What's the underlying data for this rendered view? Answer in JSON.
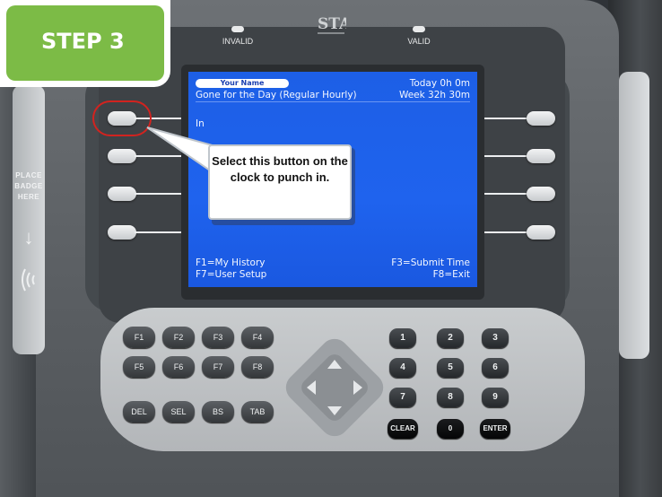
{
  "step": {
    "label": "STEP 3"
  },
  "device": {
    "indicators": [
      {
        "label": "INVALID"
      },
      {
        "label": "VALID"
      }
    ],
    "badge_area": {
      "text": "PLACE BADGE HERE"
    }
  },
  "screen": {
    "user_name": "Your Name",
    "today": "Today  0h 0m",
    "status": "Gone for the Day (Regular Hourly)",
    "week": "Week  32h 30m",
    "action": "In",
    "f1": "F1=My History",
    "f3": "F3=Submit Time",
    "f7": "F7=User Setup",
    "f8": "F8=Exit"
  },
  "callout": {
    "text": "Select this button on the clock to punch in."
  },
  "keypad": {
    "fkeys_row1": [
      "F1",
      "F2",
      "F3",
      "F4"
    ],
    "fkeys_row2": [
      "F5",
      "F6",
      "F7",
      "F8"
    ],
    "edit_keys": [
      "DEL",
      "SEL",
      "BS",
      "TAB"
    ],
    "num_row1": [
      "1",
      "2",
      "3"
    ],
    "num_row2": [
      "4",
      "5",
      "6"
    ],
    "num_row3": [
      "7",
      "8",
      "9"
    ],
    "num_row4": [
      "CLEAR",
      "0",
      "ENTER"
    ]
  },
  "colors": {
    "screen_blue": "#1f63ee",
    "step_green": "#7cbb46",
    "highlight_red": "#d2231f"
  }
}
